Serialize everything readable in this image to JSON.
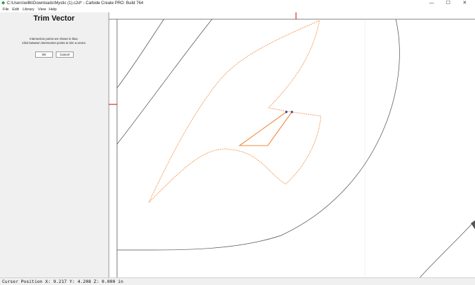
{
  "window": {
    "title": "C:\\Users\\willk\\Downloads\\Mystic (1).c2d* - Carbide Create PRO: Build 764",
    "minimize_glyph": "—",
    "maximize_glyph": "☐",
    "close_glyph": "✕",
    "icon": "carbide-create-app-icon"
  },
  "menu": {
    "items": [
      "File",
      "Edit",
      "Library",
      "View",
      "Help"
    ]
  },
  "panel": {
    "title": "Trim Vector",
    "hint_line1": "Intersection points are shown in blue.",
    "hint_line2": "Click between intersection points to trim a vector.",
    "ok_label": "OK",
    "cancel_label": "Cancel"
  },
  "status": {
    "cursor_position": "Cursor Position X: 9.217 Y: 4.208 Z: 0.000 in"
  },
  "colors": {
    "vector_selected": "#f08a3c",
    "vector_normal": "#4a4a4a",
    "intersection_point": "#3a3aa0",
    "origin_marker": "#cc0000"
  }
}
